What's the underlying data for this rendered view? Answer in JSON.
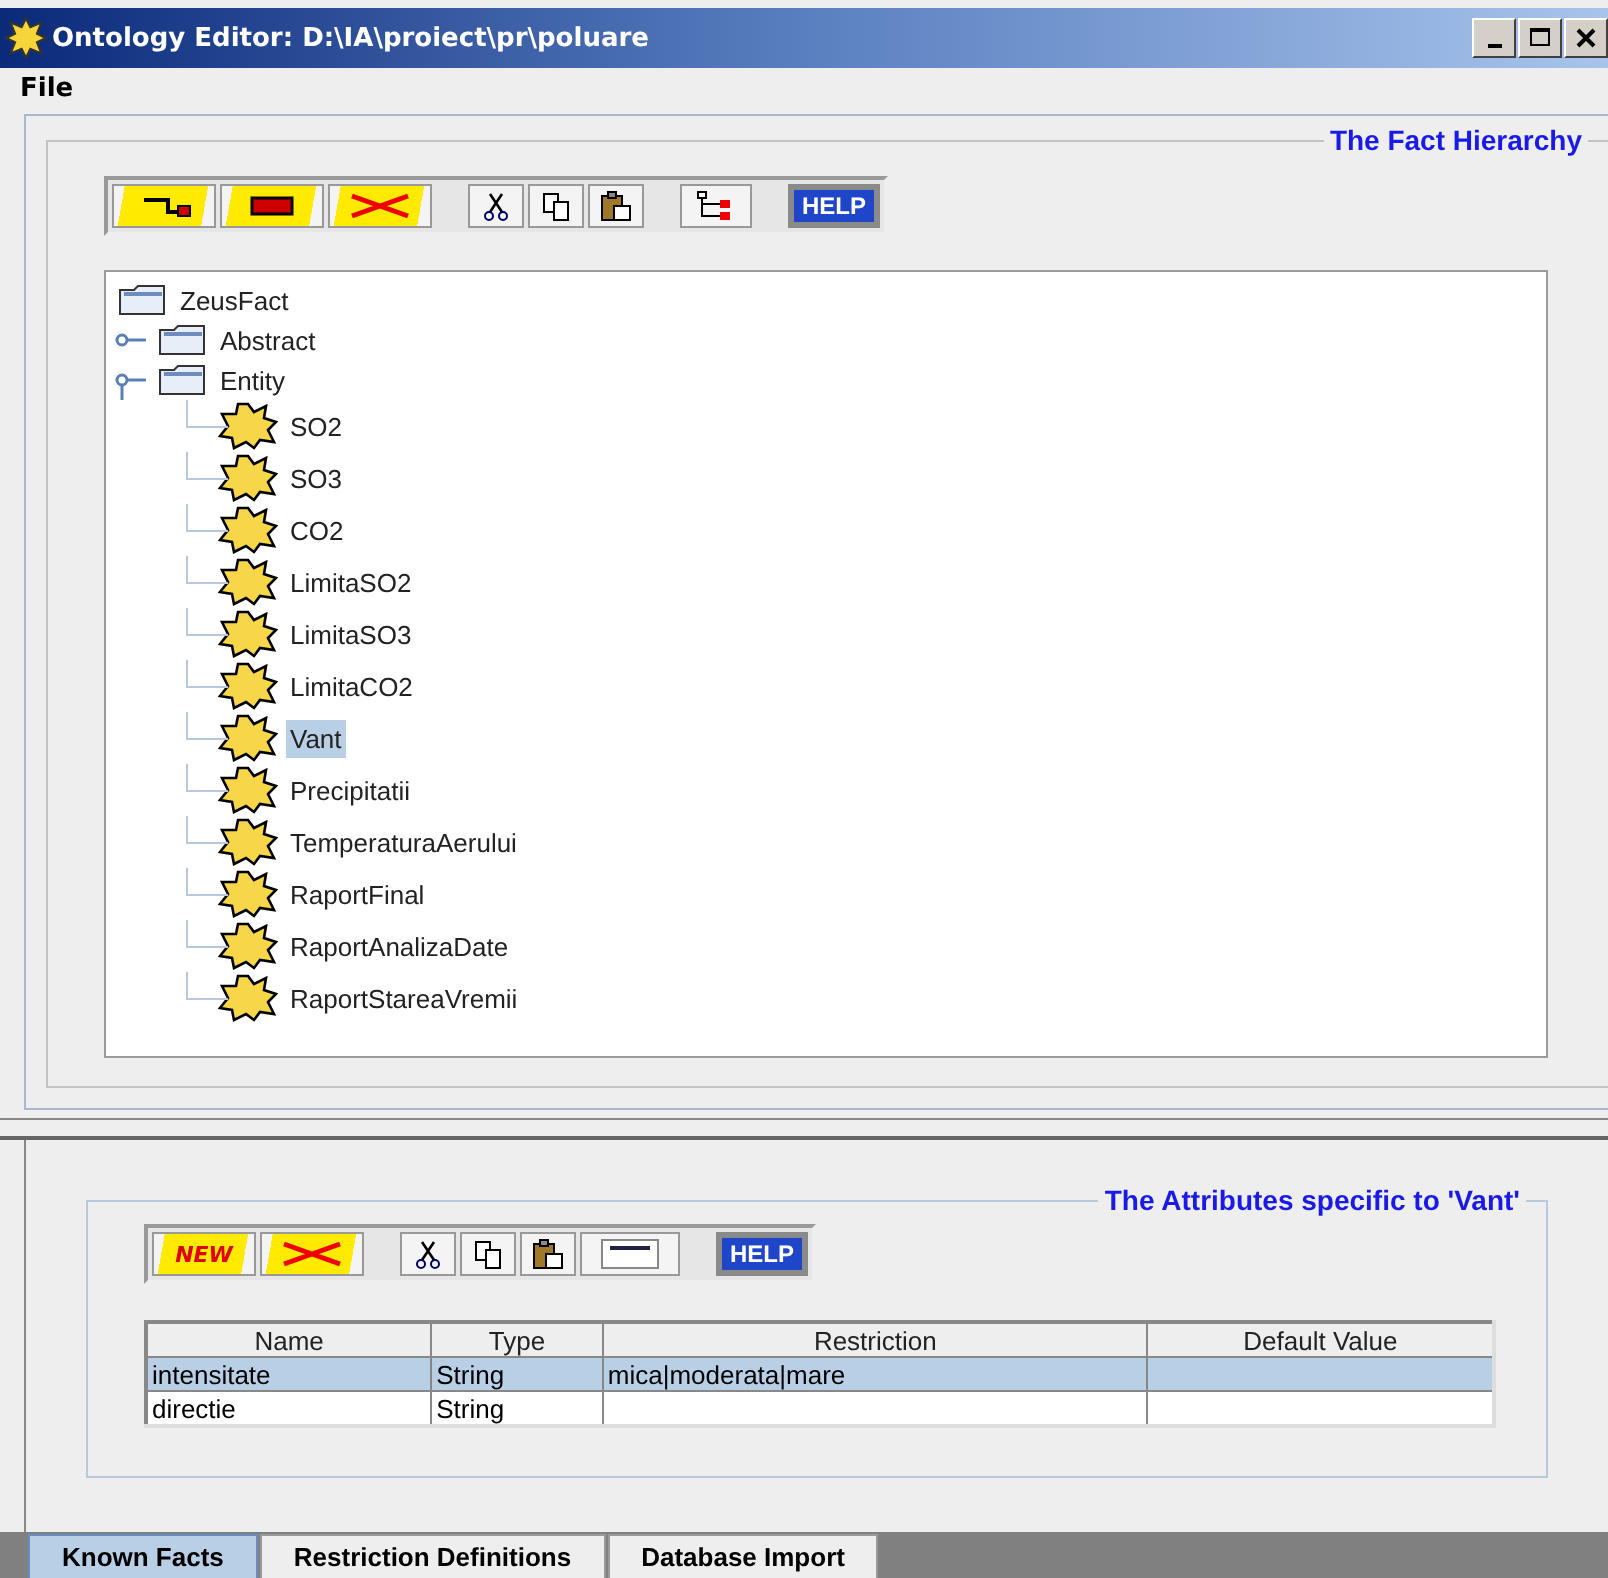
{
  "window": {
    "title": "Ontology Editor: D:\\IA\\proiect\\pr\\poluare"
  },
  "menu": [
    "File"
  ],
  "fact_hierarchy": {
    "title": "The Fact Hierarchy",
    "toolbar": [
      {
        "kind": "add-child"
      },
      {
        "kind": "add-sibling"
      },
      {
        "kind": "delete"
      },
      {
        "kind": "gap"
      },
      {
        "kind": "cut"
      },
      {
        "kind": "copy"
      },
      {
        "kind": "paste"
      },
      {
        "kind": "gap"
      },
      {
        "kind": "tree"
      },
      {
        "kind": "gap"
      },
      {
        "kind": "help",
        "label": "HELP"
      }
    ],
    "tree": {
      "label": "ZeusFact",
      "kind": "folder",
      "selected": false,
      "children": [
        {
          "label": "Abstract",
          "kind": "folder",
          "expanded": false,
          "selected": false
        },
        {
          "label": "Entity",
          "kind": "folder",
          "expanded": true,
          "selected": false,
          "children": [
            {
              "label": "SO2",
              "kind": "fact",
              "selected": false
            },
            {
              "label": "SO3",
              "kind": "fact",
              "selected": false
            },
            {
              "label": "CO2",
              "kind": "fact",
              "selected": false
            },
            {
              "label": "LimitaSO2",
              "kind": "fact",
              "selected": false
            },
            {
              "label": "LimitaSO3",
              "kind": "fact",
              "selected": false
            },
            {
              "label": "LimitaCO2",
              "kind": "fact",
              "selected": false
            },
            {
              "label": "Vant",
              "kind": "fact",
              "selected": true
            },
            {
              "label": "Precipitatii",
              "kind": "fact",
              "selected": false
            },
            {
              "label": "TemperaturaAerului",
              "kind": "fact",
              "selected": false
            },
            {
              "label": "RaportFinal",
              "kind": "fact",
              "selected": false
            },
            {
              "label": "RaportAnalizaDate",
              "kind": "fact",
              "selected": false
            },
            {
              "label": "RaportStareaVremii",
              "kind": "fact",
              "selected": false
            }
          ]
        }
      ]
    }
  },
  "attributes": {
    "title": "The Attributes specific to 'Vant'",
    "toolbar": [
      {
        "kind": "new",
        "label": "NEW"
      },
      {
        "kind": "delete"
      },
      {
        "kind": "gap"
      },
      {
        "kind": "cut"
      },
      {
        "kind": "copy"
      },
      {
        "kind": "paste"
      },
      {
        "kind": "row"
      },
      {
        "kind": "gap"
      },
      {
        "kind": "help",
        "label": "HELP"
      }
    ],
    "table": {
      "columns": [
        "Name",
        "Type",
        "Restriction",
        "Default Value"
      ],
      "rows": [
        {
          "cells": [
            "intensitate",
            "String",
            "mica|moderata|mare",
            ""
          ],
          "selected": true
        },
        {
          "cells": [
            "directie",
            "String",
            "",
            ""
          ],
          "selected": false
        }
      ]
    }
  },
  "tabs": [
    {
      "label": "Known Facts",
      "selected": true
    },
    {
      "label": "Restriction Definitions",
      "selected": false
    },
    {
      "label": "Database Import",
      "selected": false
    }
  ]
}
